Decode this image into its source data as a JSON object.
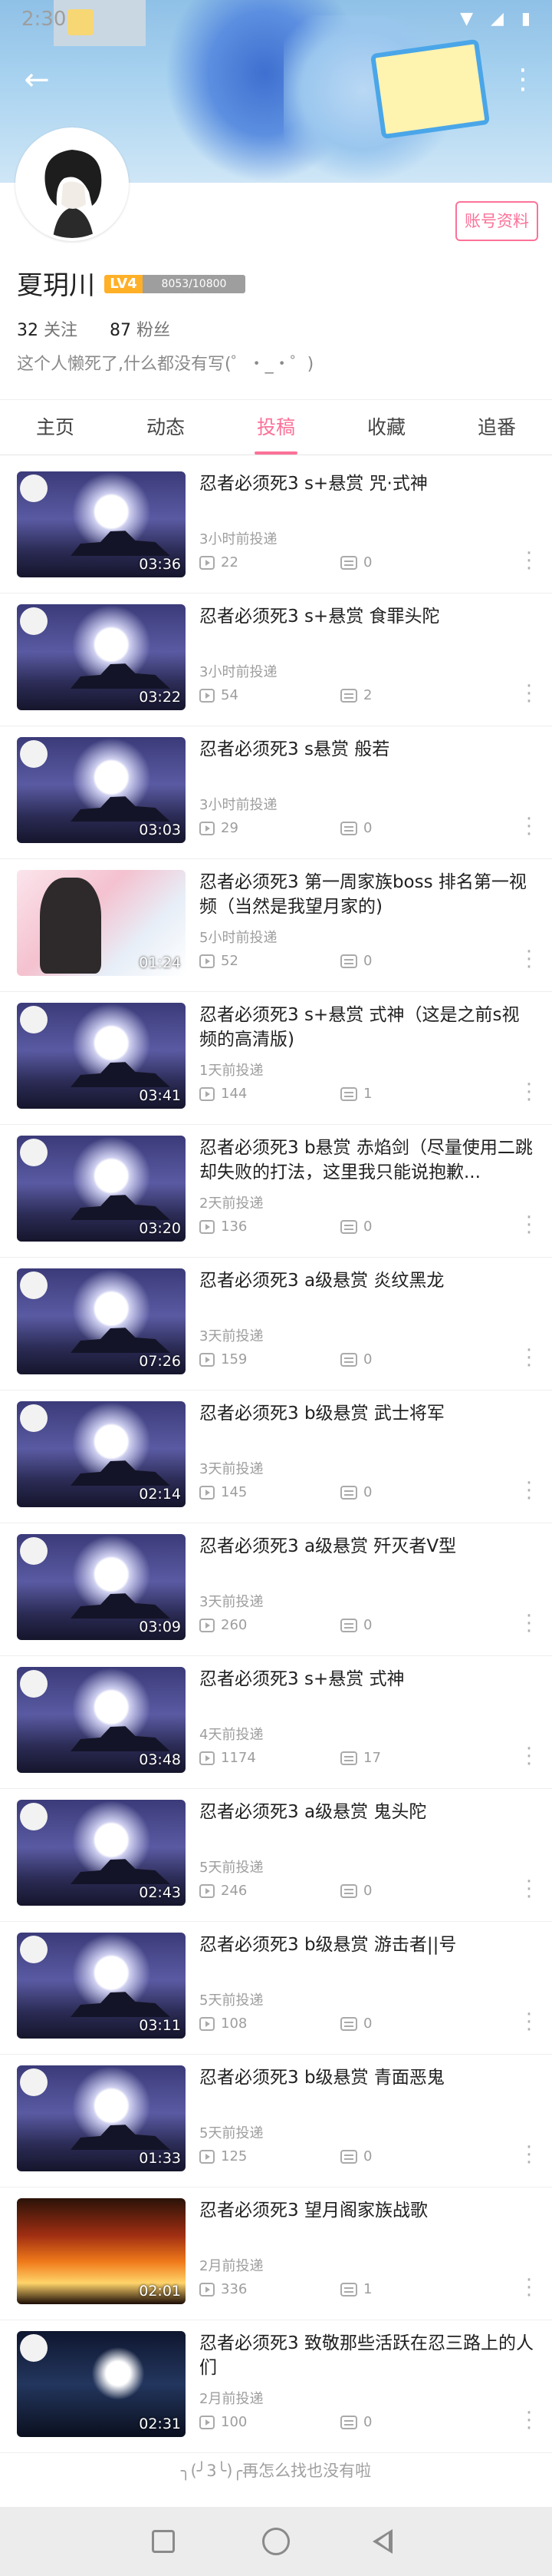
{
  "status_bar": {
    "time": "2:30",
    "icons": "▼ ◢ ▮"
  },
  "header": {
    "back_icon": "arrow-left-icon",
    "more_icon": "more-vertical-icon"
  },
  "profile": {
    "name": "夏玥川",
    "level": "LV4",
    "exp": "8053/10800",
    "following_count": "32",
    "following_label": "关注",
    "fans_count": "87",
    "fans_label": "粉丝",
    "bio": "这个人懒死了,什么都没有写(゜・_・゜)",
    "account_button": "账号资料"
  },
  "tabs": [
    {
      "label": "主页",
      "active": false
    },
    {
      "label": "动态",
      "active": false
    },
    {
      "label": "投稿",
      "active": true
    },
    {
      "label": "收藏",
      "active": false
    },
    {
      "label": "追番",
      "active": false
    }
  ],
  "videos": [
    {
      "title": "忍者必须死3 s+悬赏 咒·式神",
      "time": "3小时前投递",
      "plays": "22",
      "danmaku": "0",
      "duration": "03:36",
      "thumb": "moon"
    },
    {
      "title": "忍者必须死3 s+悬赏 食罪头陀",
      "time": "3小时前投递",
      "plays": "54",
      "danmaku": "2",
      "duration": "03:22",
      "thumb": "moon"
    },
    {
      "title": "忍者必须死3 s悬赏  般若",
      "time": "3小时前投递",
      "plays": "29",
      "danmaku": "0",
      "duration": "03:03",
      "thumb": "moon"
    },
    {
      "title": "忍者必须死3 第一周家族boss 排名第一视频（当然是我望月家的)",
      "time": "5小时前投递",
      "plays": "52",
      "danmaku": "0",
      "duration": "01:24",
      "thumb": "girl"
    },
    {
      "title": "忍者必须死3   s+悬赏 式神（这是之前s视频的高清版)",
      "time": "1天前投递",
      "plays": "144",
      "danmaku": "1",
      "duration": "03:41",
      "thumb": "moon"
    },
    {
      "title": "忍者必须死3  b悬赏 赤焰剑（尽量使用二跳却失败的打法，这里我只能说抱歉...",
      "time": "2天前投递",
      "plays": "136",
      "danmaku": "0",
      "duration": "03:20",
      "thumb": "moon"
    },
    {
      "title": "忍者必须死3 a级悬赏 炎纹黑龙",
      "time": "3天前投递",
      "plays": "159",
      "danmaku": "0",
      "duration": "07:26",
      "thumb": "moon"
    },
    {
      "title": "忍者必须死3 b级悬赏 武士将军",
      "time": "3天前投递",
      "plays": "145",
      "danmaku": "0",
      "duration": "02:14",
      "thumb": "moon"
    },
    {
      "title": "忍者必须死3 a级悬赏 歼灭者V型",
      "time": "3天前投递",
      "plays": "260",
      "danmaku": "0",
      "duration": "03:09",
      "thumb": "moon"
    },
    {
      "title": "忍者必须死3 s+悬赏 式神",
      "time": "4天前投递",
      "plays": "1174",
      "danmaku": "17",
      "duration": "03:48",
      "thumb": "moon"
    },
    {
      "title": "忍者必须死3 a级悬赏 鬼头陀",
      "time": "5天前投递",
      "plays": "246",
      "danmaku": "0",
      "duration": "02:43",
      "thumb": "moon"
    },
    {
      "title": "忍者必须死3  b级悬赏 游击者||号",
      "time": "5天前投递",
      "plays": "108",
      "danmaku": "0",
      "duration": "03:11",
      "thumb": "moon"
    },
    {
      "title": "忍者必须死3  b级悬赏   青面恶鬼",
      "time": "5天前投递",
      "plays": "125",
      "danmaku": "0",
      "duration": "01:33",
      "thumb": "moon"
    },
    {
      "title": "忍者必须死3   望月阁家族战歌",
      "time": "2月前投递",
      "plays": "336",
      "danmaku": "1",
      "duration": "02:01",
      "thumb": "fire"
    },
    {
      "title": "忍者必须死3     致敬那些活跃在忍三路上的人们",
      "time": "2月前投递",
      "plays": "100",
      "danmaku": "0",
      "duration": "02:31",
      "thumb": "dark"
    }
  ],
  "list_end": "╮(╯3╰)╭再怎么找也没有啦",
  "nav": {
    "recent": "square-icon",
    "home": "circle-icon",
    "back": "triangle-back-icon"
  }
}
